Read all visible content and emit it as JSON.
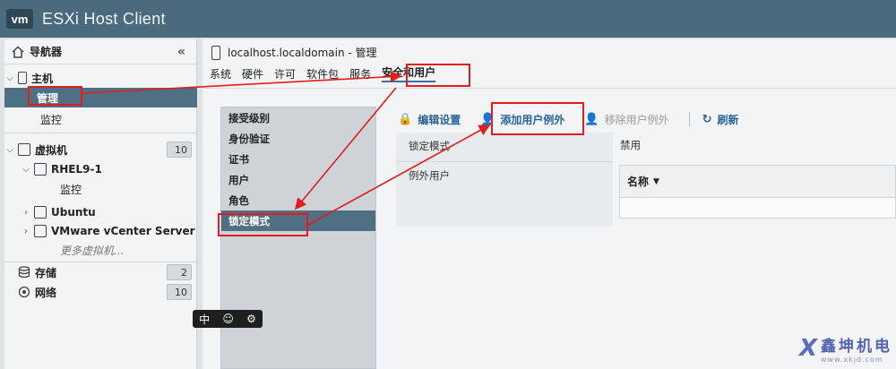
{
  "titlebar": {
    "logo": "vm",
    "title": "ESXi Host Client"
  },
  "navigator": {
    "header": "导航器",
    "collapse_glyph": "«",
    "items": [
      {
        "label": "主机",
        "icon": "host-icon"
      },
      {
        "label": "管理",
        "selected": true
      },
      {
        "label": "监控"
      },
      {
        "label": "虚拟机",
        "icon": "vm-group-icon",
        "count": "10"
      },
      {
        "label": "RHEL9-1",
        "icon": "vm-icon"
      },
      {
        "label": "监控"
      },
      {
        "label": "Ubuntu",
        "icon": "vm-icon"
      },
      {
        "label": "VMware vCenter Server",
        "icon": "vm-icon"
      },
      {
        "label": "更多虚拟机..."
      },
      {
        "label": "存储",
        "icon": "storage-icon",
        "count": "2"
      },
      {
        "label": "网络",
        "icon": "network-icon",
        "count": "10"
      }
    ]
  },
  "main": {
    "title": "localhost.localdomain - 管理",
    "menu": [
      "系统",
      "硬件",
      "许可",
      "软件包",
      "服务",
      "安全和用户"
    ],
    "active_menu": "安全和用户",
    "subnav": [
      "接受级别",
      "身份验证",
      "证书",
      "用户",
      "角色",
      "锁定模式"
    ],
    "selected_subnav": "锁定模式",
    "toolbar": {
      "edit": "编辑设置",
      "add": "添加用户例外",
      "remove": "移除用户例外",
      "refresh": "刷新"
    },
    "rows": {
      "lockdown_mode_label": "锁定模式",
      "lockdown_mode_value": "禁用",
      "exception_users_label": "例外用户"
    },
    "grid": {
      "column_name": "名称"
    }
  },
  "ime": {
    "mode": "中",
    "emoji": "☺",
    "settings": "⚙"
  },
  "watermark": {
    "name": "鑫坤机电",
    "url": "www.xkjd.com"
  },
  "colors": {
    "titlebar": "#4a6a7e",
    "selected": "#4f6f84",
    "link": "#2a6496",
    "annotation": "#e41c1c"
  }
}
